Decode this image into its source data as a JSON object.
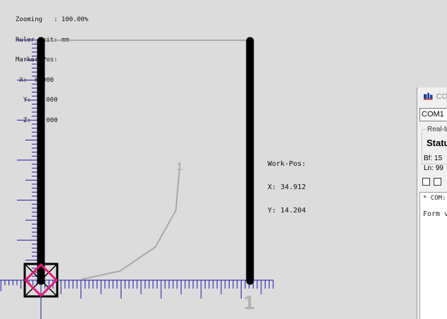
{
  "info": {
    "zoom_label": "Zooming",
    "zoom_value": "100.00%",
    "ruler_label": "Ruler_Unit:",
    "ruler_value": "mm",
    "marker_label": "Marker-Pos:",
    "marker_x": "0.000",
    "marker_y": "0.000",
    "marker_z": "0.000"
  },
  "work_pos": {
    "label": "Work-Pos:",
    "x": "34.912",
    "y": "14.204"
  },
  "labels": {
    "path_marker": "1",
    "axis_marker": "1"
  },
  "side_panel": {
    "title": "CO",
    "port": "COM1",
    "group_label": "Real-ti",
    "status": "Statu",
    "bf_label": "Bf:",
    "bf_value": "15",
    "ln_label": "Ln:",
    "ln_value": "99",
    "log_line1": "* COM:",
    "log_line2": "Form v"
  },
  "colors": {
    "background": "#dcdcdc",
    "ruler": "#1a1aa6",
    "marker": "#e6197a",
    "path": "#a9a9a9"
  }
}
